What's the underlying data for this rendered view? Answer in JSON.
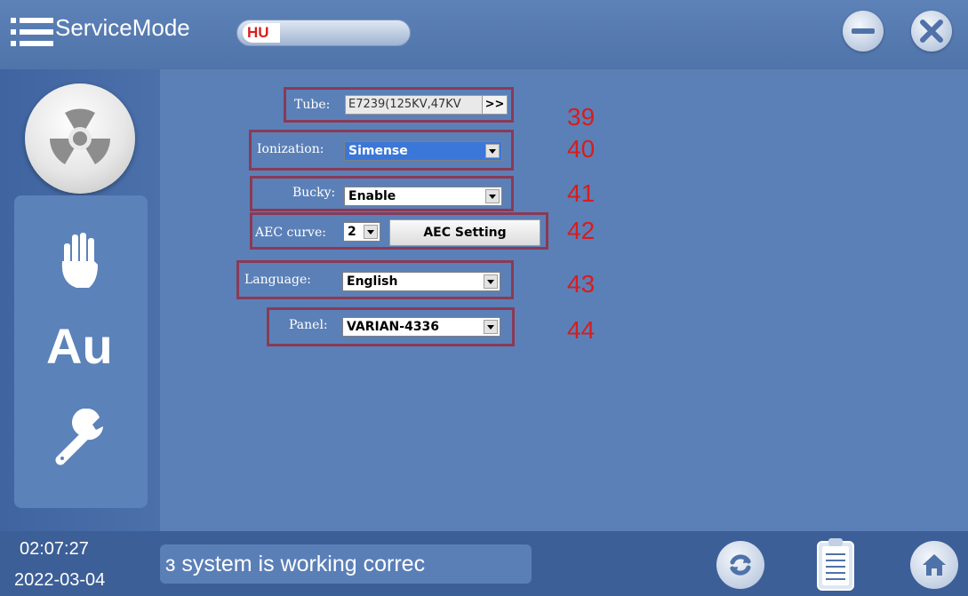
{
  "header": {
    "title": "ServiceMode",
    "hu_label": "HU",
    "icons": [
      "menu-icon",
      "minimize-icon",
      "close-icon"
    ]
  },
  "sidebar": {
    "items": [
      {
        "icon": "radiation-icon"
      },
      {
        "icon": "hand-icon"
      },
      {
        "icon": "au-icon",
        "label": "Au"
      },
      {
        "icon": "wrench-icon"
      }
    ]
  },
  "form": {
    "tube": {
      "label": "Tube:",
      "value": "E7239(125KV,47KV",
      "more": ">>",
      "number": "39"
    },
    "ionization": {
      "label": "Ionization:",
      "value": "Simense",
      "number": "40"
    },
    "bucky": {
      "label": "Bucky:",
      "value": "Enable",
      "number": "41"
    },
    "aec": {
      "label": "AEC curve:",
      "value": "2",
      "button": "AEC Setting",
      "number": "42"
    },
    "language": {
      "label": "Language:",
      "value": "English",
      "number": "43"
    },
    "panel": {
      "label": "Panel:",
      "value": "VARIAN-4336",
      "number": "44"
    }
  },
  "footer": {
    "time": "02:07:27",
    "date": "2022-03-04",
    "status": "ɜ system is working correc",
    "icons": [
      "refresh-icon",
      "clipboard-icon",
      "home-icon"
    ]
  },
  "colors": {
    "background": "#5b7fb3",
    "highlight_box": "#8a3a56",
    "number_red": "#d91c1c"
  }
}
